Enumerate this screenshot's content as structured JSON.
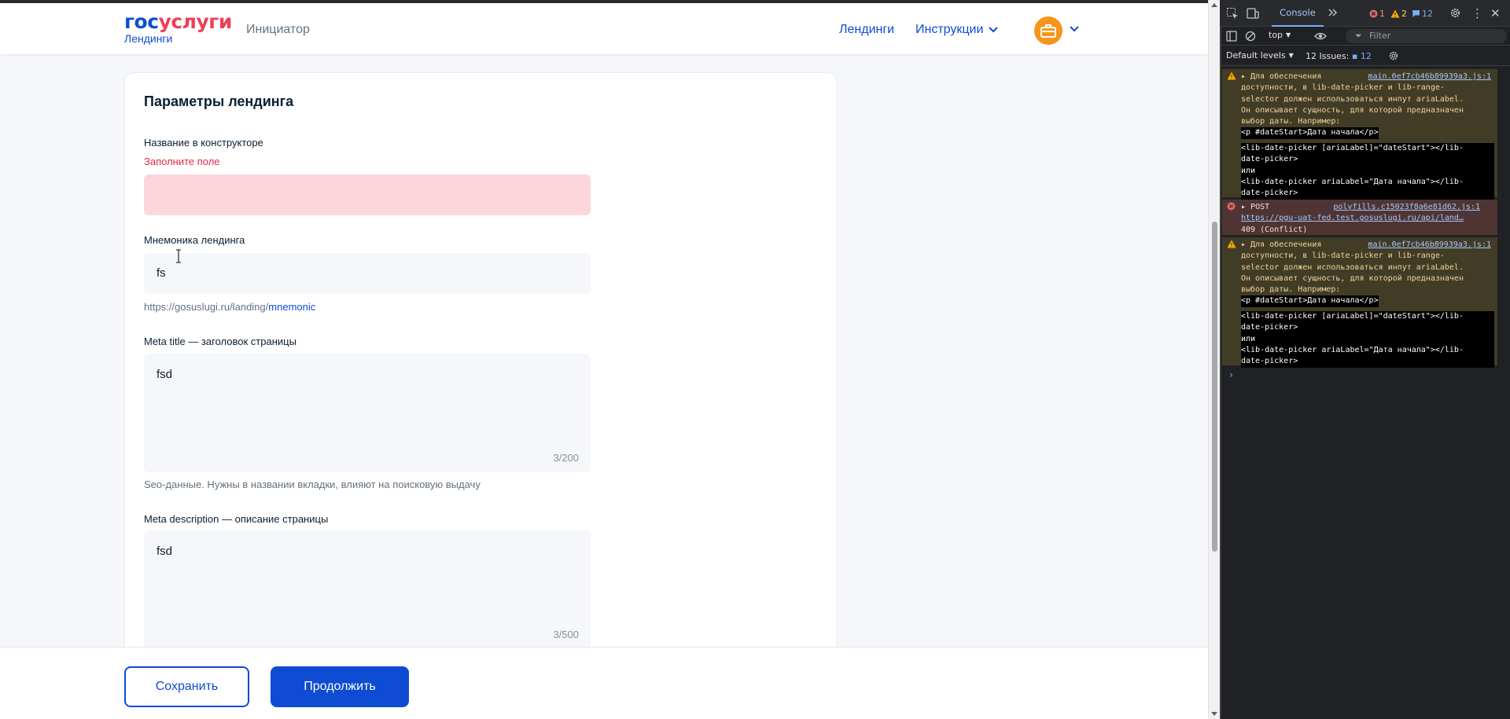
{
  "page": {
    "logo": {
      "part1": "гос",
      "part2": "услуги",
      "subtitle": "Лендинги"
    },
    "initiator": "Инициатор",
    "nav": {
      "landings": "Лендинги",
      "instructions": "Инструкции"
    },
    "card": {
      "title": "Параметры лендинга",
      "name_label": "Название в конструкторе",
      "name_error": "Заполните поле",
      "name_value": "",
      "mnemonic_label": "Мнемоника лендинга",
      "mnemonic_value": "fs",
      "url_prefix": "https://gosuslugi.ru/landing/",
      "url_suffix": "mnemonic",
      "meta_title_label": "Meta title — заголовок страницы",
      "meta_title_value": "fsd",
      "meta_title_counter": "3/200",
      "seo_hint": "Seo-данные. Нужны в названии вкладки, влияют на поисковую выдачу",
      "meta_desc_label": "Meta description — описание страницы",
      "meta_desc_value": "fsd",
      "meta_desc_counter": "3/500"
    },
    "footer": {
      "save": "Сохранить",
      "continue": "Продолжить"
    }
  },
  "devtools": {
    "tab": "Console",
    "error_count": "1",
    "warn_count": "2",
    "issue_count": "12",
    "context": "top",
    "filter_placeholder": "Filter",
    "levels": "Default levels",
    "issues_label": "12 Issues:",
    "issues_badge": "12",
    "messages": [
      {
        "type": "warn",
        "source": "main.0ef7cb46b89939a3.js:1",
        "lines": [
          "Для обеспечения",
          "доступности, в lib-date-picker и lib-range-",
          "selector должен использоваться инпут ariaLabel.",
          "Он описывает сущность, для которой предназначен",
          "выбор даты. Например:"
        ],
        "code": [
          "<p #dateStart>Дата начала</p>",
          "<lib-date-picker [ariaLabel]=\"dateStart\"></lib-",
          "date-picker>",
          "или",
          "<lib-date-picker ariaLabel=\"Дата начала\"></lib-",
          "date-picker>"
        ]
      },
      {
        "type": "error",
        "method": "POST",
        "source": "polyfills.c15023f8a6e81d62.js:1",
        "url": "https://pgu-uat-fed.test.gosuslugi.ru/api/land…",
        "status": "409 (Conflict)"
      },
      {
        "type": "warn",
        "source": "main.0ef7cb46b89939a3.js:1",
        "lines": [
          "Для обеспечения",
          "доступности, в lib-date-picker и lib-range-",
          "selector должен использоваться инпут ariaLabel.",
          "Он описывает сущность, для которой предназначен",
          "выбор даты. Например:"
        ],
        "code": [
          "<p #dateStart>Дата начала</p>",
          "<lib-date-picker [ariaLabel]=\"dateStart\"></lib-",
          "date-picker>",
          "или",
          "<lib-date-picker ariaLabel=\"Дата начала\"></lib-",
          "date-picker>"
        ]
      }
    ]
  },
  "colors": {
    "brand_blue": "#0d4cd3",
    "brand_red": "#ee3f58",
    "error_red": "#e1284d",
    "avatar_orange": "#f7941d"
  }
}
